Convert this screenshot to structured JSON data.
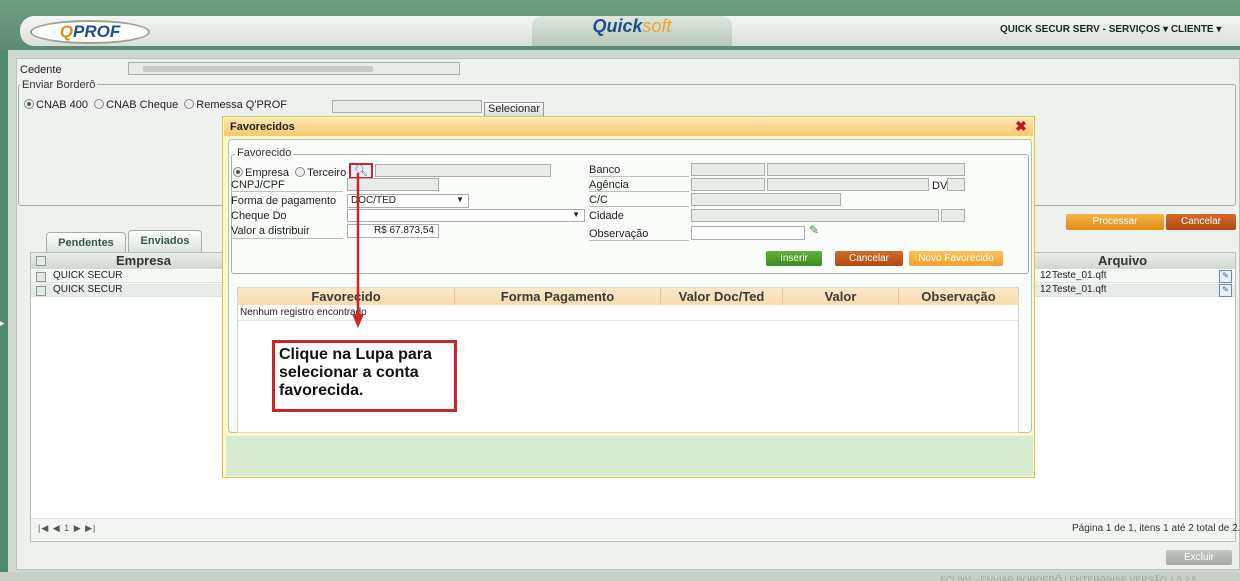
{
  "header": {
    "logo_text_o": "Q",
    "logo_text_rest": "PROF",
    "center_q": "Quick",
    "center_s": "soft",
    "user_company": "QUICK SECUR SERV - SERVIÇOS",
    "user_menu": "CLIENTE"
  },
  "form": {
    "cedente_label": "Cedente",
    "enviar_bordero_legend": "Enviar Borderô",
    "radio_cnab400": "CNAB 400",
    "radio_cnab_cheque": "CNAB Cheque",
    "radio_remessa": "Remessa Q'PROF",
    "selecionar_label": "Selecionar",
    "processar_label": "Processar",
    "cancelar_label": "Cancelar"
  },
  "tabs": {
    "pendentes": "Pendentes",
    "enviados": "Enviados"
  },
  "table": {
    "col_empresa": "Empresa",
    "col_arquivo": "Arquivo",
    "rows": [
      {
        "empresa": "QUICK SECUR",
        "arquivo_prefix": "12",
        "arquivo": "Teste_01.qft"
      },
      {
        "empresa": "QUICK SECUR",
        "arquivo_prefix": "12",
        "arquivo": "Teste_01.qft"
      }
    ],
    "pager_nav": "|◀ ◀ 1 ▶ ▶|",
    "pager_info": "Página 1 de 1, itens 1 até 2 total de 2.",
    "excluir_label": "Excluir"
  },
  "dialog": {
    "title": "Favorecidos",
    "close_icon": "✖",
    "favorecido_legend": "Favorecido",
    "radio_empresa": "Empresa",
    "radio_terceiro": "Terceiro",
    "cnpj_label": "CNPJ/CPF",
    "forma_label": "Forma de pagamento",
    "forma_value": "DOC/TED",
    "cheque_label": "Cheque Do",
    "valor_label": "Valor a distribuir",
    "valor_value": "R$ 67.873,54",
    "banco_label": "Banco",
    "agencia_label": "Agência",
    "dv_label": "DV",
    "cc_label": "C/C",
    "cidade_label": "Cidade",
    "observacao_label": "Observação",
    "inserir_label": "Inserir",
    "cancelar_label": "Cancelar",
    "novo_label": "Novo Favorecido",
    "grid_cols": [
      "Favorecido",
      "Forma Pagamento",
      "Valor Doc/Ted",
      "Valor",
      "Observação"
    ],
    "empty_text": "Nenhum registro encontrado"
  },
  "callout": {
    "text": "Clique na Lupa para selecionar a conta favorecida."
  },
  "footer_version": "ECL001 - ENVIAR BORDERÔ | ENTERPRISE VERSÃO 1.0.2.5",
  "colors": {
    "green_button": "#4d9a2a",
    "orange_button": "#f0a030",
    "brown_button": "#c0551e",
    "annotation_red": "#c8262a"
  }
}
